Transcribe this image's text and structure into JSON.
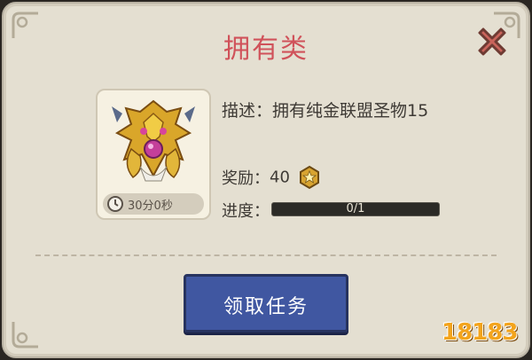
{
  "dialog": {
    "title": "拥有类",
    "close_icon": "close-x-icon"
  },
  "quest": {
    "relic_icon": "golden-dragon-relic-icon",
    "timer_icon": "clock-icon",
    "timer_text": "30分0秒",
    "description": "描述：拥有纯金联盟圣物15",
    "reward_label": "奖励：",
    "reward_value": "40",
    "reward_icon": "gold-star-coin-icon",
    "progress_label": "进度：",
    "progress_text": "0/1",
    "progress_fraction": 0.0
  },
  "action": {
    "accept_label": "领取任务"
  },
  "watermark": {
    "text": "18183",
    "icon": "site-logo-watermark"
  },
  "colors": {
    "title": "#d0525a",
    "panel": "#e4dfd1",
    "button": "#4057a1",
    "progress_track": "#2b2a26"
  }
}
